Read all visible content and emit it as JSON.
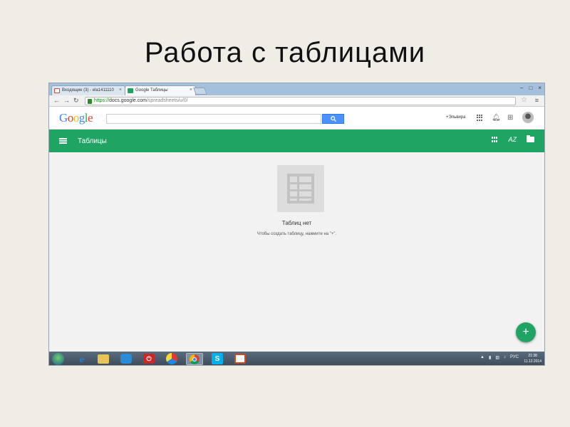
{
  "slide_title": "Работа с таблицами",
  "browser": {
    "tabs": [
      {
        "label": "Входящие (3) - ela1411110",
        "icon": "gmail-icon",
        "icon_color": "#d14836"
      },
      {
        "label": "Google Таблицы",
        "icon": "sheets-icon",
        "icon_color": "#1fa463"
      }
    ],
    "tab_close": "×",
    "window_buttons": [
      "–",
      "□",
      "×"
    ],
    "url": {
      "scheme": "https://",
      "host": "docs.google.com",
      "path": "/spreadsheets/u/0/"
    }
  },
  "google_header": {
    "logo": "Google",
    "logo_colors": [
      "#4285f4",
      "#ea4335",
      "#fbbc05",
      "#4285f4",
      "#34a853",
      "#ea4335"
    ],
    "user_link": "+Эльвира"
  },
  "app_bar": {
    "title": "Таблицы",
    "accent": "#1fa463",
    "sort_label": "AZ"
  },
  "empty_state": {
    "title": "Таблиц нет",
    "hint": "Чтобы создать таблицу, нажмите на \"+\"."
  },
  "fab_label": "+",
  "taskbar": {
    "items": [
      {
        "name": "ie-icon",
        "color": "#1e7fd0",
        "glyph": "e"
      },
      {
        "name": "explorer-icon",
        "color": "#e8c35a",
        "glyph": ""
      },
      {
        "name": "app-icon",
        "color": "#2a8bd6",
        "glyph": ""
      },
      {
        "name": "power-icon",
        "color": "#c8282a",
        "glyph": "⏻"
      },
      {
        "name": "yandex-browser-icon",
        "color": "#e9e9e9",
        "glyph": ""
      },
      {
        "name": "chrome-icon",
        "color": "#e9e9e9",
        "glyph": ""
      },
      {
        "name": "skype-icon",
        "color": "#00aff0",
        "glyph": "S"
      },
      {
        "name": "powerpoint-icon",
        "color": "#d24726",
        "glyph": ""
      }
    ],
    "tray_lang": "РУС",
    "time": "21:38",
    "date": "11.12.2014"
  }
}
